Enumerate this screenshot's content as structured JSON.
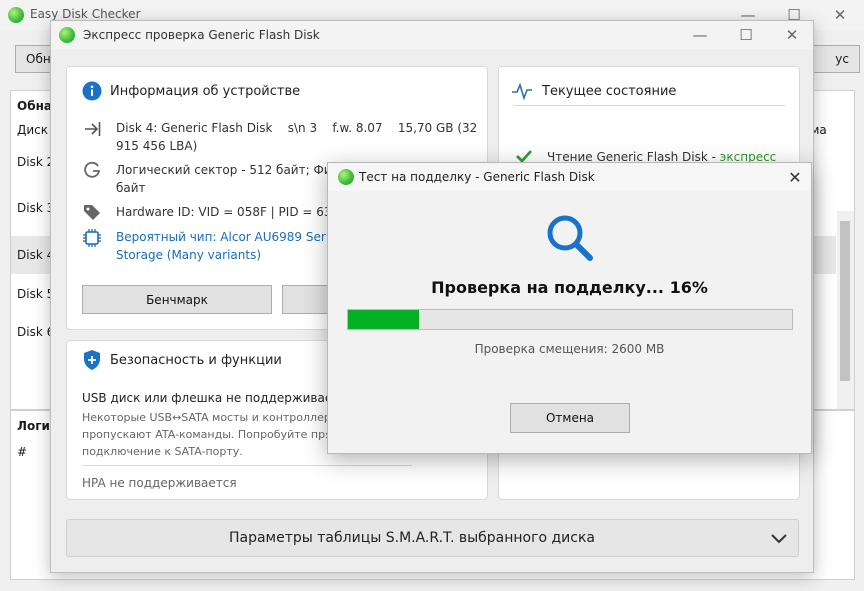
{
  "main_window": {
    "title": "Easy Disk Checker",
    "button_left": "Обн",
    "button_right": "ус",
    "list_header": "Обнар",
    "col_disk": "Диск",
    "col_right": "ема",
    "rows": [
      "Disk 2",
      "Disk 3",
      "Disk 4",
      "Disk 5",
      "Disk 6"
    ],
    "lower_header": "Логич",
    "lower_col": "#"
  },
  "express_window": {
    "title": "Экспресс проверка Generic Flash Disk",
    "device_info": {
      "title": "Информация об устройстве",
      "line_disk": "Disk 4: Generic Flash Disk    s\\n 3    f.w. 8.07    15,70 GB (32",
      "line_disk2": "915 456 LBA)",
      "line_sector": "Логический сектор - 512 байт; Физи",
      "line_sector2": "байт",
      "line_hw": "Hardware ID: VID = 058F | PID = 638",
      "line_chip": "Вероятный чип: Alcor AU6989 Seri",
      "line_chip2": "Storage (Many variants)",
      "benchmark_button": "Бенчмарк"
    },
    "current_state": {
      "title": "Текущее состояние",
      "reading_label": "Чтение Generic Flash Disk - ",
      "reading_mode": "экспресс"
    },
    "security": {
      "title": "Безопасность и функции",
      "usb_line": "USB диск или флешка не поддерживает А",
      "note1": "Некоторые USB↔SATA мосты и контроллеры",
      "note2": "пропускают ATA-команды. Попробуйте прям",
      "note3": "подключение к SATA-порту.",
      "hpa": "HPA не поддерживается"
    },
    "smart_section": "Параметры таблицы S.M.A.R.T. выбранного диска"
  },
  "fake_test_dialog": {
    "title": "Тест на подделку - Generic Flash Disk",
    "status": "Проверка на подделку... 16%",
    "progress_fraction": 0.16,
    "offset_text": "Проверка смещения: 2600 MB",
    "cancel_button": "Отмена",
    "accent_color": "#06b025"
  },
  "icons": [
    "app-logo-icon",
    "minimize-icon",
    "maximize-icon",
    "close-icon",
    "info-icon",
    "arrow-right-icon",
    "sector-icon",
    "tag-icon",
    "chip-icon",
    "pulse-icon",
    "checkmark-icon",
    "shield-icon",
    "search-icon",
    "chevron-down-icon"
  ]
}
